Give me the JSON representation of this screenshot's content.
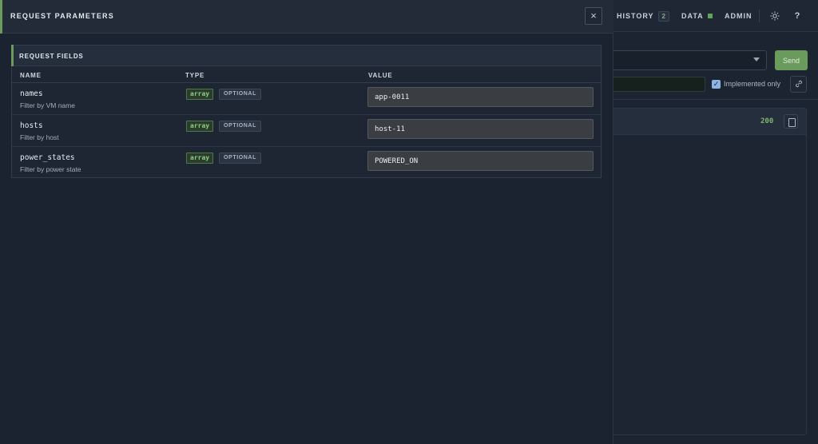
{
  "background": {
    "nav": {
      "history_label": "HISTORY",
      "history_count": "2",
      "data_label": "DATA",
      "admin_label": "ADMIN",
      "help_label": "?"
    },
    "send_label": "Send",
    "implemented_only_label": "Implemented only",
    "response_status": "200"
  },
  "drawer": {
    "title": "REQUEST PARAMETERS",
    "close_label": "×",
    "fields_title": "REQUEST FIELDS",
    "columns": {
      "name": "NAME",
      "type": "TYPE",
      "value": "VALUE"
    },
    "fields": [
      {
        "name": "names",
        "description": "Filter by VM name",
        "type": "array",
        "requirement": "OPTIONAL",
        "value": "app-0011"
      },
      {
        "name": "hosts",
        "description": "Filter by host",
        "type": "array",
        "requirement": "OPTIONAL",
        "value": "host-11"
      },
      {
        "name": "power_states",
        "description": "Filter by power state",
        "type": "array",
        "requirement": "OPTIONAL",
        "value": "POWERED_ON"
      }
    ]
  },
  "colors": {
    "accent_green": "#6a9a5c",
    "background": "#1b2230",
    "panel": "#1e2533"
  }
}
